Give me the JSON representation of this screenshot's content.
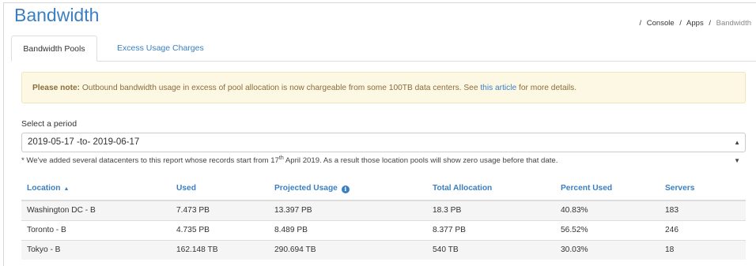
{
  "header": {
    "title": "Bandwidth",
    "breadcrumb": [
      {
        "label": "Console"
      },
      {
        "label": "Apps"
      },
      {
        "label": "Bandwidth"
      }
    ],
    "separator": "/"
  },
  "tabs": [
    {
      "label": "Bandwidth Pools",
      "active": true
    },
    {
      "label": "Excess Usage Charges",
      "active": false
    }
  ],
  "alert": {
    "prefix": "Please note:",
    "text": " Outbound bandwidth usage in excess of pool allocation is now chargeable from some 100TB data centers. See ",
    "link": "this article",
    "suffix": " for more details."
  },
  "period": {
    "label": "Select a period",
    "selected": "2019-05-17 -to- 2019-06-17"
  },
  "footnote": {
    "before": "* We've added several datacenters to this report whose records start from 17",
    "sup": "th",
    "after": " April 2019. As a result those location pools will show zero usage before that date."
  },
  "table": {
    "headers": {
      "location": "Location",
      "used": "Used",
      "projected": "Projected Usage",
      "total": "Total Allocation",
      "percent": "Percent Used",
      "servers": "Servers"
    },
    "rows": [
      {
        "location": "Washington DC - B",
        "used": "7.473 PB",
        "projected": "13.397 PB",
        "total": "18.3 PB",
        "percent": "40.83%",
        "servers": "183"
      },
      {
        "location": "Toronto - B",
        "used": "4.735 PB",
        "projected": "8.489 PB",
        "total": "8.377 PB",
        "percent": "56.52%",
        "servers": "246"
      },
      {
        "location": "Tokyo - B",
        "used": "162.148 TB",
        "projected": "290.694 TB",
        "total": "540 TB",
        "percent": "30.03%",
        "servers": "18"
      }
    ]
  },
  "colors": {
    "accent": "#3a7fc2",
    "alert_bg": "#fcf8e3",
    "alert_text": "#8a6d3b"
  },
  "icons": {
    "sort": "sort-asc-icon",
    "info": "info-icon",
    "select_caret": "select-caret-icon"
  }
}
